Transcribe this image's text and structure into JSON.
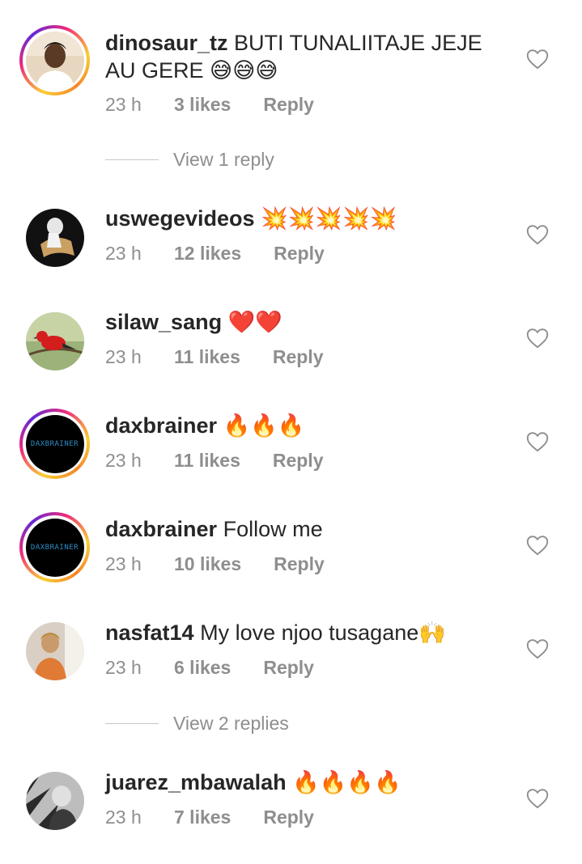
{
  "comments": [
    {
      "username": "dinosaur_tz",
      "text": "BUTI TUNALIITAJE JEJE AU GERE",
      "emojis": "😅😅😅",
      "time": "23 h",
      "likes": "3 likes",
      "reply": "Reply",
      "avatar": "person-avatar",
      "story_ring": true,
      "view_replies": "View 1 reply"
    },
    {
      "username": "uswegevideos",
      "text": "",
      "emojis": "💥💥💥💥💥",
      "time": "23 h",
      "likes": "12 likes",
      "reply": "Reply",
      "avatar": "person-avatar",
      "story_ring": false
    },
    {
      "username": "silaw_sang",
      "text": "",
      "emojis": "❤️❤️",
      "time": "23 h",
      "likes": "11 likes",
      "reply": "Reply",
      "avatar": "bird-avatar",
      "story_ring": false
    },
    {
      "username": "daxbrainer",
      "text": "",
      "emojis": "🔥🔥🔥",
      "time": "23 h",
      "likes": "11 likes",
      "reply": "Reply",
      "avatar": "logo-avatar",
      "avatar_text": "DAXBRAINER",
      "story_ring": true
    },
    {
      "username": "daxbrainer",
      "text": "Follow me",
      "emojis": "",
      "time": "23 h",
      "likes": "10 likes",
      "reply": "Reply",
      "avatar": "logo-avatar",
      "avatar_text": "DAXBRAINER",
      "story_ring": true
    },
    {
      "username": "nasfat14",
      "text": "My love njoo tusagane",
      "emojis": "🙌",
      "time": "23 h",
      "likes": "6 likes",
      "reply": "Reply",
      "avatar": "person-avatar",
      "story_ring": false,
      "view_replies": "View 2 replies"
    },
    {
      "username": "juarez_mbawalah",
      "text": "",
      "emojis": "🔥🔥🔥🔥",
      "time": "23 h",
      "likes": "7 likes",
      "reply": "Reply",
      "avatar": "person-avatar",
      "story_ring": false
    }
  ],
  "colors": {
    "primary_text": "#262626",
    "secondary_text": "#8e8e8e",
    "background": "#ffffff"
  },
  "icons": {
    "like": "heart-outline-icon"
  }
}
